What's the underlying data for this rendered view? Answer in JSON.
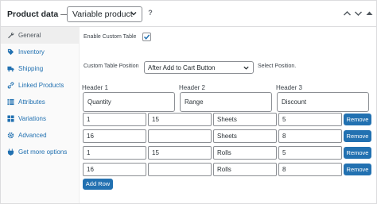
{
  "header": {
    "title": "Product data",
    "separator": "—",
    "product_type": "Variable product",
    "help": "?"
  },
  "sidebar": {
    "items": [
      {
        "label": "General",
        "icon": "wrench-icon",
        "active": true
      },
      {
        "label": "Inventory",
        "icon": "tag-icon",
        "active": false
      },
      {
        "label": "Shipping",
        "icon": "truck-icon",
        "active": false
      },
      {
        "label": "Linked Products",
        "icon": "link-icon",
        "active": false
      },
      {
        "label": "Attributes",
        "icon": "list-icon",
        "active": false
      },
      {
        "label": "Variations",
        "icon": "grid-icon",
        "active": false
      },
      {
        "label": "Advanced",
        "icon": "gear-icon",
        "active": false
      },
      {
        "label": "Get more options",
        "icon": "plugin-icon",
        "active": false
      }
    ]
  },
  "settings": {
    "enable_label": "Enable Custom Table",
    "enable_checked": true,
    "position_label": "Custom Table Position",
    "position_value": "After Add to Cart Button",
    "position_hint": "Select Position."
  },
  "table": {
    "header_names": [
      "Header 1",
      "Header 2",
      "Header 3"
    ],
    "header_values": [
      "Quantity",
      "Range",
      "Discount"
    ],
    "rows": [
      [
        "1",
        "15",
        "Sheets",
        "5"
      ],
      [
        "16",
        "",
        "Sheets",
        "8"
      ],
      [
        "1",
        "15",
        "Rolls",
        "5"
      ],
      [
        "16",
        "",
        "Rolls",
        "8"
      ]
    ],
    "remove_label": "Remove",
    "add_row_label": "Add Row"
  },
  "colors": {
    "accent": "#2271b1",
    "link": "#2271b1",
    "border": "#8c8f94"
  }
}
